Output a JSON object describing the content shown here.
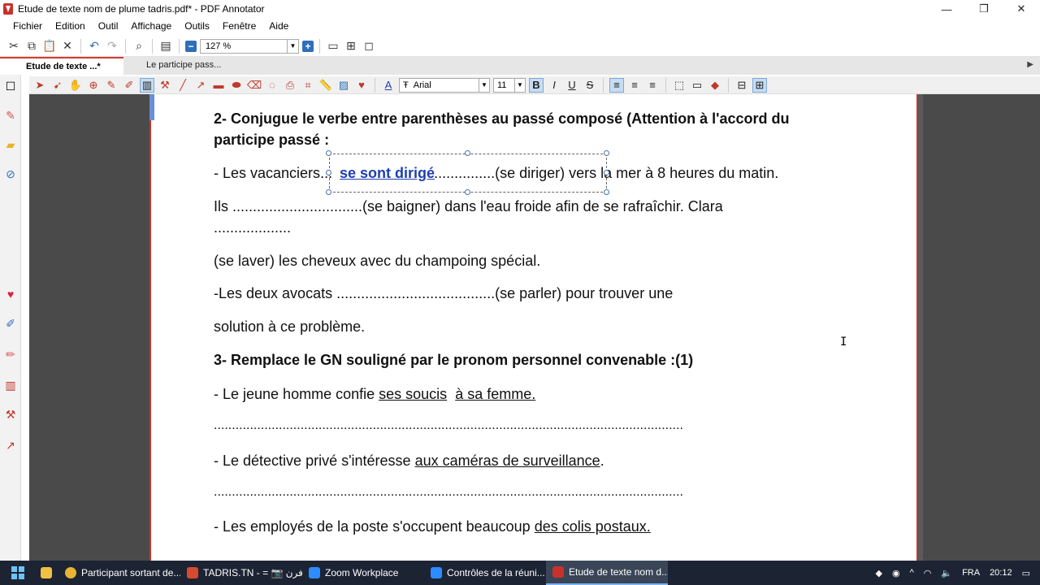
{
  "window": {
    "title": "Etude de texte nom de plume tadris.pdf* - PDF Annotator",
    "minimize": "—",
    "restore": "❐",
    "close": "✕"
  },
  "menu": [
    "Fichier",
    "Edition",
    "Outil",
    "Affichage",
    "Outils",
    "Fenêtre",
    "Aide"
  ],
  "toolbar": {
    "zoom": "127 %"
  },
  "tabs": [
    {
      "label": "Etude de texte ...*",
      "active": true
    },
    {
      "label": "Le participe pass...",
      "active": false
    }
  ],
  "format": {
    "font": "Arial",
    "size": "11",
    "bold": "B",
    "italic": "I",
    "underline": "U",
    "strike": "S",
    "font_prefix": "Ŧ"
  },
  "document": {
    "q2_line1": "2- Conjugue le verbe entre parenthèses au passé composé (Attention à l'accord du",
    "q2_line2": "participe passé :",
    "l1_a": "- Les vacanciers",
    "l1_b": "...",
    "l1_dots": "...............",
    "l1_c": "(se diriger) vers la mer à 8 heures du matin.",
    "annotation": "se sont dirigé",
    "l2": " Ils ................................(se baigner) dans l'eau froide afin de se rafraîchir. Clara",
    "l3": "...................",
    "l4": "(se laver) les cheveux avec du champoing spécial.",
    "l5": "-Les deux avocats .......................................(se parler) pour trouver une",
    "l6": "solution à ce problème.",
    "q3": "3- Remplace le GN souligné par le pronom personnel convenable :(1)",
    "l7_a": "- Le jeune homme confie ",
    "l7_u1": "ses soucis",
    "l7_sp": "  ",
    "l7_u2": "à sa femme.",
    "dotline": "..................................................................................................................................",
    "l8_a": "- Le détective privé s'intéresse ",
    "l8_u": "aux caméras de surveillance",
    "l8_b": ".",
    "l9_a": "- Les employés de la poste s'occupent beaucoup ",
    "l9_u": "des colis postaux."
  },
  "taskbar": {
    "items": [
      {
        "label": "Participant sortant de...",
        "color": "#e8b233"
      },
      {
        "label": "TADRIS.TN - = 📷 فرن...",
        "color": "#d64b2f"
      },
      {
        "label": "Zoom Workplace",
        "color": "#2d8cff"
      },
      {
        "label": "Contrôles de la réuni...",
        "color": "#2d8cff"
      },
      {
        "label": "Etude de texte nom d...",
        "color": "#c8312b"
      }
    ],
    "lang": "FRA",
    "time": "20:12"
  },
  "colors": {
    "accent": "#c0392b",
    "annotation_blue": "#1f3fb0"
  }
}
